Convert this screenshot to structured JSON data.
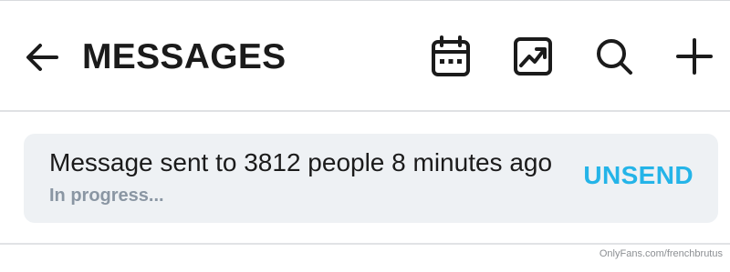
{
  "header": {
    "title": "MESSAGES",
    "icons": {
      "back": "arrow-left-icon",
      "calendar": "calendar-icon",
      "image": "image-chart-icon",
      "search": "search-icon",
      "add": "plus-icon"
    }
  },
  "notice": {
    "message": "Message sent to 3812 people 8 minutes ago",
    "status": "In progress...",
    "action_label": "UNSEND"
  },
  "watermark": "OnlyFans.com/frenchbrutus",
  "colors": {
    "text": "#1b1b1b",
    "accent": "#24b4e8",
    "muted": "#8a96a3",
    "card_bg": "#eef1f4",
    "divider": "#dfe1e4"
  }
}
